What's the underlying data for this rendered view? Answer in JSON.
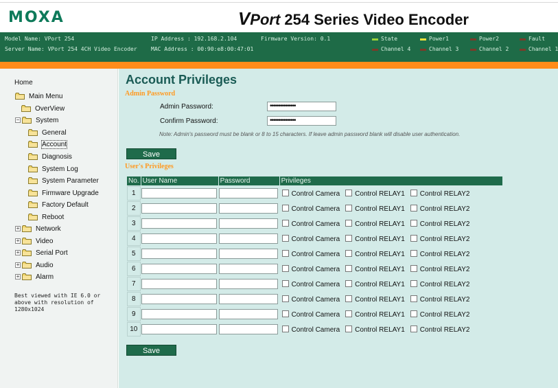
{
  "header": {
    "logo": "MOXA",
    "title_v": "V",
    "title_port": "Port",
    "title_rest": " 254 Series Video Encoder"
  },
  "status_bar": {
    "model_name": "Model Name: VPort 254",
    "server_name": "Server Name: VPort 254 4CH Video Encoder",
    "ip_address": "IP Address : 192.168.2.104",
    "mac_address": "MAC Address : 00:90:e8:00:47:01",
    "firmware": "Firmware Version: 0.1",
    "indicators_row1": [
      {
        "label": "State",
        "color": "#9ad23a"
      },
      {
        "label": "Power1",
        "color": "#f3e23c"
      },
      {
        "label": "Power2",
        "color": "#7a3b2a"
      },
      {
        "label": "Fault",
        "color": "#7a3b2a"
      }
    ],
    "indicators_row2": [
      {
        "label": "Channel 4",
        "color": "#7a3b2a"
      },
      {
        "label": "Channel 3",
        "color": "#7a3b2a"
      },
      {
        "label": "Channel 2",
        "color": "#7a3b2a"
      },
      {
        "label": "Channel 1",
        "color": "#7a3b2a"
      }
    ]
  },
  "nav": {
    "home": "Home",
    "items": [
      {
        "label": "Main Menu",
        "expander": ""
      },
      {
        "label": "OverView",
        "expander": ""
      },
      {
        "label": "System",
        "expander": "−"
      },
      {
        "label": "General",
        "expander": ""
      },
      {
        "label": "Account",
        "expander": "",
        "selected": true
      },
      {
        "label": "Diagnosis",
        "expander": ""
      },
      {
        "label": "System Log",
        "expander": ""
      },
      {
        "label": "System Parameter",
        "expander": ""
      },
      {
        "label": "Firmware Upgrade",
        "expander": ""
      },
      {
        "label": "Factory Default",
        "expander": ""
      },
      {
        "label": "Reboot",
        "expander": ""
      },
      {
        "label": "Network",
        "expander": "+"
      },
      {
        "label": "Video",
        "expander": "+"
      },
      {
        "label": "Serial Port",
        "expander": "+"
      },
      {
        "label": "Audio",
        "expander": "+"
      },
      {
        "label": "Alarm",
        "expander": "+"
      }
    ],
    "note": "Best viewed with IE 6.0 or above with resolution of 1280x1024"
  },
  "main": {
    "page_title": "Account Privileges",
    "admin_section": "Admin Password",
    "admin_password_label": "Admin Password:",
    "admin_password_value": "•••••••••••••••",
    "confirm_password_label": "Confirm Password:",
    "confirm_password_value": "•••••••••••••••",
    "admin_note": "Note: Admin's password must be blank or 8 to 15 characters. If leave admin password blank will disable user authentication.",
    "save_label": "Save",
    "users_section": "User's Privileges",
    "table_headers": [
      "No.",
      "User Name",
      "Password",
      "Privileges"
    ],
    "privileges": [
      "Control Camera",
      "Control RELAY1",
      "Control RELAY2"
    ],
    "rows": [
      "1",
      "2",
      "3",
      "4",
      "5",
      "6",
      "7",
      "8",
      "9",
      "10"
    ],
    "save_label_bottom": "Save"
  }
}
